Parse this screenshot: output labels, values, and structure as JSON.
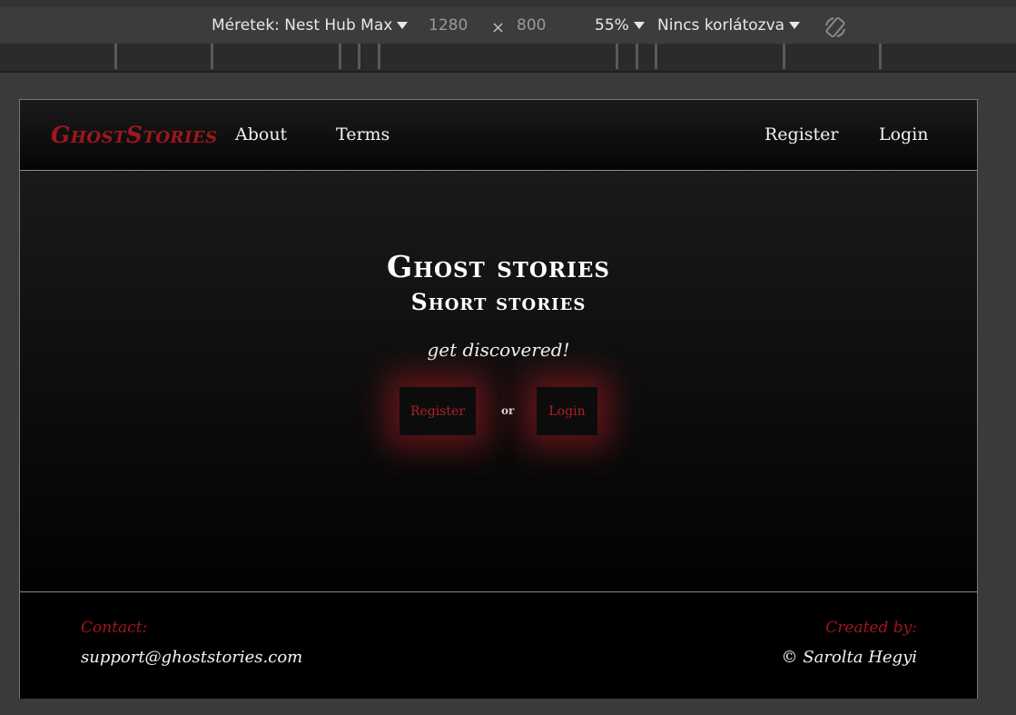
{
  "devtools": {
    "dimensions_label": "Méretek: Nest Hub Max",
    "width": "1280",
    "times": "×",
    "height": "800",
    "zoom": "55%",
    "throttle": "Nincs korlátozva",
    "rotate_icon": "rotate-icon"
  },
  "nav": {
    "brand": "GhostStories",
    "links": [
      "About",
      "Terms"
    ],
    "register": "Register",
    "login": "Login"
  },
  "hero": {
    "title": "Ghost stories",
    "subtitle": "Short stories",
    "tagline": "get discovered!",
    "register_button": "Register",
    "or": "or",
    "login_button": "Login"
  },
  "footer": {
    "contact_label": "Contact:",
    "contact_value": "support@ghoststories.com",
    "created_label": "Created by:",
    "created_value": "© Sarolta Hegyi"
  },
  "colors": {
    "brand_red": "#a1161e",
    "glow_red": "#c81e28"
  }
}
